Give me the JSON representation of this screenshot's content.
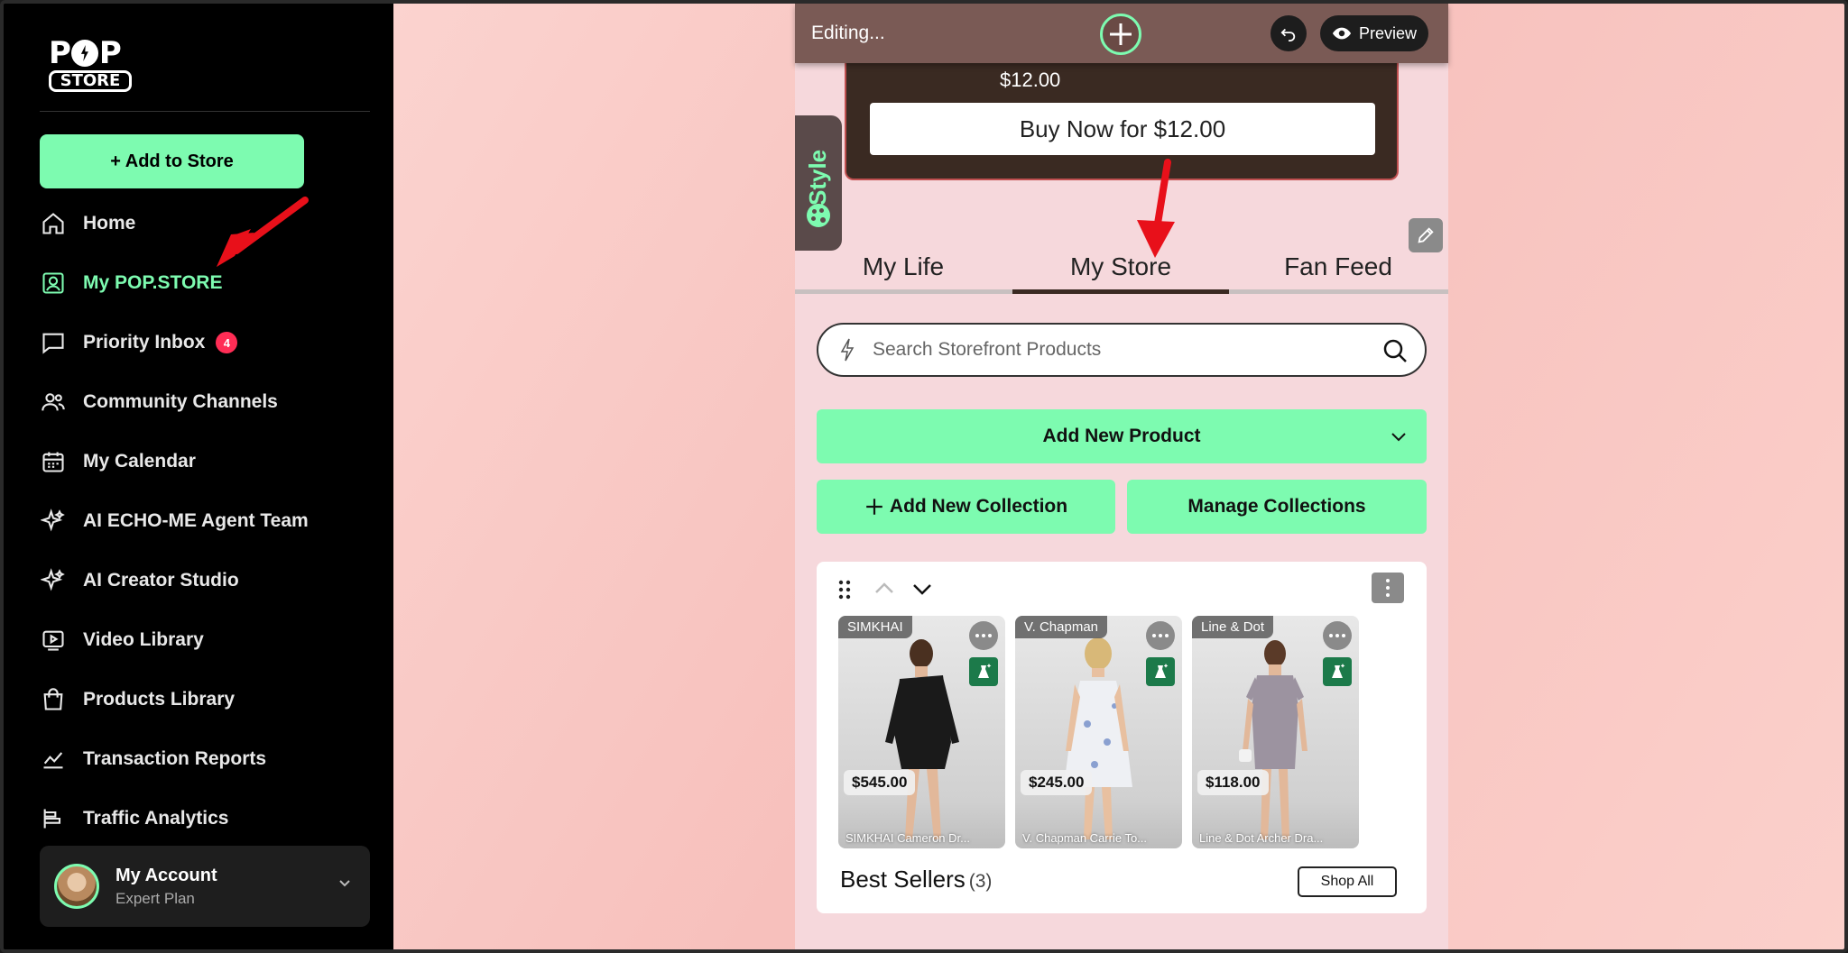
{
  "sidebar": {
    "logo_top": "POP",
    "logo_bottom": "STORE",
    "add_button": "+ Add to Store",
    "items": [
      {
        "label": "Home",
        "icon": "home-icon"
      },
      {
        "label": "My POP.STORE",
        "icon": "user-square-icon",
        "active": true
      },
      {
        "label": "Priority Inbox",
        "icon": "message-icon",
        "badge": "4"
      },
      {
        "label": "Community Channels",
        "icon": "users-icon"
      },
      {
        "label": "My Calendar",
        "icon": "calendar-icon"
      },
      {
        "label": "AI ECHO-ME Agent Team",
        "icon": "sparkle-icon"
      },
      {
        "label": "AI Creator Studio",
        "icon": "sparkle-icon"
      },
      {
        "label": "Video Library",
        "icon": "video-icon"
      },
      {
        "label": "Products Library",
        "icon": "bag-icon"
      },
      {
        "label": "Transaction Reports",
        "icon": "chart-line-icon"
      },
      {
        "label": "Traffic Analytics",
        "icon": "bar-chart-icon"
      }
    ],
    "account": {
      "name": "My Account",
      "plan": "Expert Plan"
    }
  },
  "editbar": {
    "status": "Editing...",
    "preview_label": "Preview"
  },
  "product_card": {
    "price": "$12.00",
    "buy_label": "Buy Now for $12.00"
  },
  "style_tab": {
    "label": "Style"
  },
  "tabs": [
    {
      "label": "My Life"
    },
    {
      "label": "My Store",
      "active": true
    },
    {
      "label": "Fan Feed"
    }
  ],
  "search": {
    "placeholder": "Search Storefront Products"
  },
  "actions": {
    "add_product": "Add New Product",
    "add_collection": "Add New Collection",
    "manage_collections": "Manage Collections"
  },
  "collection": {
    "title": "Best Sellers",
    "count": "(3)",
    "shop_all": "Shop All",
    "products": [
      {
        "brand": "SIMKHAI",
        "price": "$545.00",
        "name": "SIMKHAI Cameron Dr...",
        "dress_color": "#1a1a1a"
      },
      {
        "brand": "V. Chapman",
        "price": "$245.00",
        "name": "V. Chapman Carrie To...",
        "dress_color": "#eef0f4"
      },
      {
        "brand": "Line & Dot",
        "price": "$118.00",
        "name": "Line & Dot Archer Dra...",
        "dress_color": "#9c93a0"
      }
    ]
  },
  "colors": {
    "accent": "#7dfbb0",
    "badge": "#ff2d55",
    "annotation": "#e8101a"
  }
}
